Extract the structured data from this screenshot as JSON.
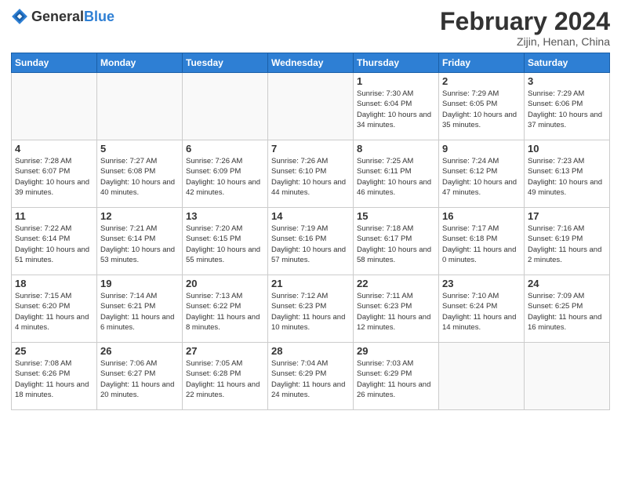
{
  "header": {
    "logo_general": "General",
    "logo_blue": "Blue",
    "month_year": "February 2024",
    "location": "Zijin, Henan, China"
  },
  "days_of_week": [
    "Sunday",
    "Monday",
    "Tuesday",
    "Wednesday",
    "Thursday",
    "Friday",
    "Saturday"
  ],
  "weeks": [
    [
      {
        "day": "",
        "info": ""
      },
      {
        "day": "",
        "info": ""
      },
      {
        "day": "",
        "info": ""
      },
      {
        "day": "",
        "info": ""
      },
      {
        "day": "1",
        "info": "Sunrise: 7:30 AM\nSunset: 6:04 PM\nDaylight: 10 hours\nand 34 minutes."
      },
      {
        "day": "2",
        "info": "Sunrise: 7:29 AM\nSunset: 6:05 PM\nDaylight: 10 hours\nand 35 minutes."
      },
      {
        "day": "3",
        "info": "Sunrise: 7:29 AM\nSunset: 6:06 PM\nDaylight: 10 hours\nand 37 minutes."
      }
    ],
    [
      {
        "day": "4",
        "info": "Sunrise: 7:28 AM\nSunset: 6:07 PM\nDaylight: 10 hours\nand 39 minutes."
      },
      {
        "day": "5",
        "info": "Sunrise: 7:27 AM\nSunset: 6:08 PM\nDaylight: 10 hours\nand 40 minutes."
      },
      {
        "day": "6",
        "info": "Sunrise: 7:26 AM\nSunset: 6:09 PM\nDaylight: 10 hours\nand 42 minutes."
      },
      {
        "day": "7",
        "info": "Sunrise: 7:26 AM\nSunset: 6:10 PM\nDaylight: 10 hours\nand 44 minutes."
      },
      {
        "day": "8",
        "info": "Sunrise: 7:25 AM\nSunset: 6:11 PM\nDaylight: 10 hours\nand 46 minutes."
      },
      {
        "day": "9",
        "info": "Sunrise: 7:24 AM\nSunset: 6:12 PM\nDaylight: 10 hours\nand 47 minutes."
      },
      {
        "day": "10",
        "info": "Sunrise: 7:23 AM\nSunset: 6:13 PM\nDaylight: 10 hours\nand 49 minutes."
      }
    ],
    [
      {
        "day": "11",
        "info": "Sunrise: 7:22 AM\nSunset: 6:14 PM\nDaylight: 10 hours\nand 51 minutes."
      },
      {
        "day": "12",
        "info": "Sunrise: 7:21 AM\nSunset: 6:14 PM\nDaylight: 10 hours\nand 53 minutes."
      },
      {
        "day": "13",
        "info": "Sunrise: 7:20 AM\nSunset: 6:15 PM\nDaylight: 10 hours\nand 55 minutes."
      },
      {
        "day": "14",
        "info": "Sunrise: 7:19 AM\nSunset: 6:16 PM\nDaylight: 10 hours\nand 57 minutes."
      },
      {
        "day": "15",
        "info": "Sunrise: 7:18 AM\nSunset: 6:17 PM\nDaylight: 10 hours\nand 58 minutes."
      },
      {
        "day": "16",
        "info": "Sunrise: 7:17 AM\nSunset: 6:18 PM\nDaylight: 11 hours\nand 0 minutes."
      },
      {
        "day": "17",
        "info": "Sunrise: 7:16 AM\nSunset: 6:19 PM\nDaylight: 11 hours\nand 2 minutes."
      }
    ],
    [
      {
        "day": "18",
        "info": "Sunrise: 7:15 AM\nSunset: 6:20 PM\nDaylight: 11 hours\nand 4 minutes."
      },
      {
        "day": "19",
        "info": "Sunrise: 7:14 AM\nSunset: 6:21 PM\nDaylight: 11 hours\nand 6 minutes."
      },
      {
        "day": "20",
        "info": "Sunrise: 7:13 AM\nSunset: 6:22 PM\nDaylight: 11 hours\nand 8 minutes."
      },
      {
        "day": "21",
        "info": "Sunrise: 7:12 AM\nSunset: 6:23 PM\nDaylight: 11 hours\nand 10 minutes."
      },
      {
        "day": "22",
        "info": "Sunrise: 7:11 AM\nSunset: 6:23 PM\nDaylight: 11 hours\nand 12 minutes."
      },
      {
        "day": "23",
        "info": "Sunrise: 7:10 AM\nSunset: 6:24 PM\nDaylight: 11 hours\nand 14 minutes."
      },
      {
        "day": "24",
        "info": "Sunrise: 7:09 AM\nSunset: 6:25 PM\nDaylight: 11 hours\nand 16 minutes."
      }
    ],
    [
      {
        "day": "25",
        "info": "Sunrise: 7:08 AM\nSunset: 6:26 PM\nDaylight: 11 hours\nand 18 minutes."
      },
      {
        "day": "26",
        "info": "Sunrise: 7:06 AM\nSunset: 6:27 PM\nDaylight: 11 hours\nand 20 minutes."
      },
      {
        "day": "27",
        "info": "Sunrise: 7:05 AM\nSunset: 6:28 PM\nDaylight: 11 hours\nand 22 minutes."
      },
      {
        "day": "28",
        "info": "Sunrise: 7:04 AM\nSunset: 6:29 PM\nDaylight: 11 hours\nand 24 minutes."
      },
      {
        "day": "29",
        "info": "Sunrise: 7:03 AM\nSunset: 6:29 PM\nDaylight: 11 hours\nand 26 minutes."
      },
      {
        "day": "",
        "info": ""
      },
      {
        "day": "",
        "info": ""
      }
    ]
  ]
}
